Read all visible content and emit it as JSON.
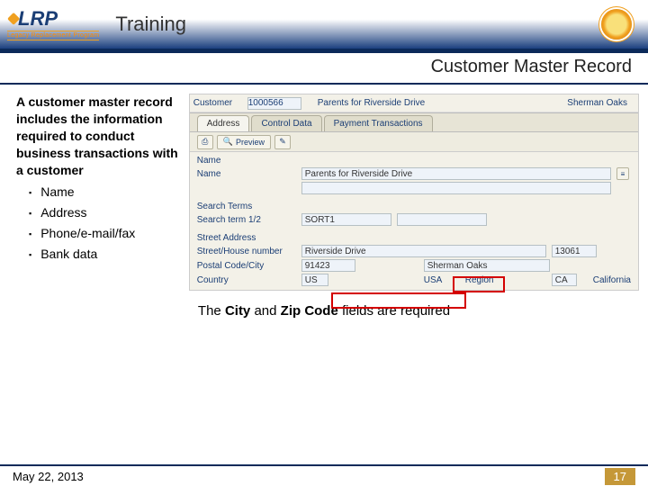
{
  "header": {
    "logo_text": "LRP",
    "logo_tag": "Legacy Replacement Program",
    "training": "Training"
  },
  "subtitle": "Customer Master Record",
  "left": {
    "para": "A customer master record includes the information required to conduct business transactions with a customer",
    "items": [
      "Name",
      "Address",
      "Phone/e-mail/fax",
      "Bank data"
    ]
  },
  "sap": {
    "top": {
      "customer_lbl": "Customer",
      "customer_val": "1000566",
      "name_lbl": "Parents for Riverside Drive",
      "city_lbl": "Sherman Oaks"
    },
    "tabs": [
      "Address",
      "Control Data",
      "Payment Transactions"
    ],
    "toolbar": {
      "preview": "Preview"
    },
    "name_section": {
      "group": "Name",
      "name_lbl": "Name",
      "name_val": "Parents for Riverside Drive"
    },
    "search_section": {
      "group": "Search Terms",
      "term_lbl": "Search term 1/2",
      "term_val": "SORT1"
    },
    "addr_section": {
      "group": "Street Address",
      "street_lbl": "Street/House number",
      "street_val": "Riverside Drive",
      "house_val": "13061",
      "postal_lbl": "Postal Code/City",
      "postal_val": "91423",
      "city_val": "Sherman Oaks",
      "country_lbl": "Country",
      "country_code": "US",
      "country_name": "USA",
      "region_lbl": "Region",
      "region_code": "CA",
      "region_name": "California"
    }
  },
  "note_pre": "The ",
  "note_b1": "City",
  "note_mid": " and ",
  "note_b2": "Zip Code",
  "note_post": " fields are required",
  "footer": {
    "date": "May 22, 2013",
    "page": "17"
  }
}
